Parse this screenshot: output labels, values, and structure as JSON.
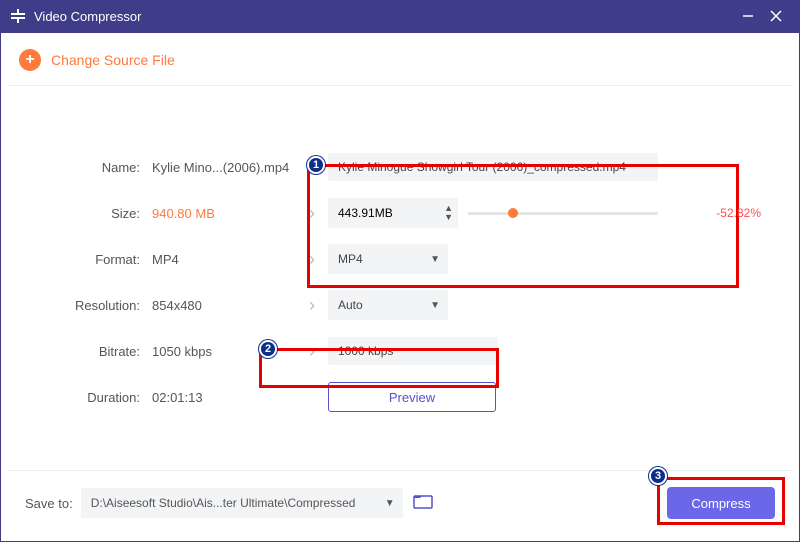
{
  "titlebar": {
    "title": "Video Compressor"
  },
  "toolbar": {
    "change_source": "Change Source File"
  },
  "labels": {
    "name": "Name:",
    "size": "Size:",
    "format": "Format:",
    "resolution": "Resolution:",
    "bitrate": "Bitrate:",
    "duration": "Duration:"
  },
  "source": {
    "name": "Kylie Mino...(2006).mp4",
    "size": "940.80 MB",
    "format": "MP4",
    "resolution": "854x480",
    "bitrate": "1050 kbps",
    "duration": "02:01:13"
  },
  "output": {
    "name": "Kylie Minogue Showgirl Tour (2006)_compressed.mp4",
    "size": "443.91MB",
    "size_pct": "-52.82%",
    "format": "MP4",
    "resolution": "Auto",
    "bitrate": "1000 kbps"
  },
  "buttons": {
    "preview": "Preview",
    "compress": "Compress"
  },
  "footer": {
    "save_label": "Save to:",
    "path": "D:\\Aiseesoft Studio\\Ais...ter Ultimate\\Compressed"
  },
  "annotations": {
    "b1": "1",
    "b2": "2",
    "b3": "3"
  }
}
